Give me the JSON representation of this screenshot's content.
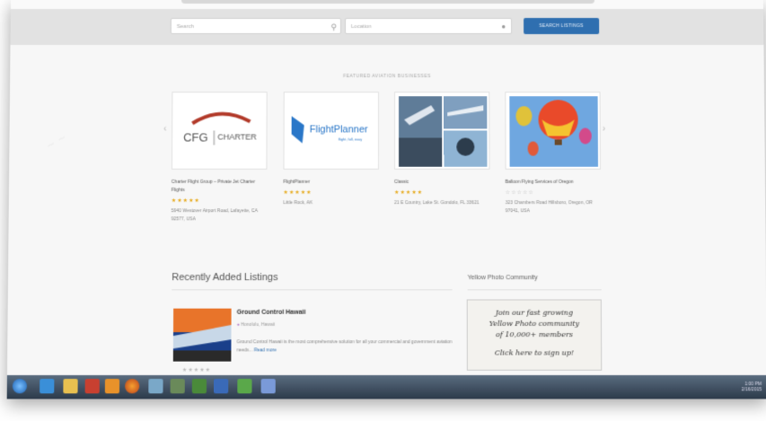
{
  "search": {
    "keyword_placeholder": "Search",
    "location_placeholder": "Location",
    "button_label": "SEARCH LISTINGS"
  },
  "featured": {
    "title": "FEATURED AVIATION BUSINESSES",
    "cards": [
      {
        "name": "Charter Flight Group – Private Jet Charter Flights",
        "stars": "★★★★★",
        "address": "5940 Westover Airport Road, Lafayette, CA 92577, USA"
      },
      {
        "name": "FlightPlanner",
        "stars": "★★★★★",
        "address": "Little Rock, AK"
      },
      {
        "name": "Classic",
        "stars": "★★★★★",
        "address": "21 E Country, Lake St. Gondolo, FL 33621"
      },
      {
        "name": "Balloon Flying Services of Oregon",
        "stars": "☆☆☆☆☆",
        "address": "323 Chambers Road Hillsboro, Oregon, OR 97041, USA"
      }
    ],
    "logo_cfg": "CFG",
    "logo_charter": "CHARTER",
    "logo_fp_brand": "FlightPlanner",
    "logo_fp_tag": "flight, full, easy"
  },
  "recent": {
    "title": "Recently Added Listings",
    "listing": {
      "name": "Ground Control Hawaii",
      "meta": "Honolulu, Hawaii",
      "description": "Ground Control Hawaii is the most comprehensive solution for all your commercial and government aviation needs...",
      "more": "Read more",
      "stars": "★★★★★"
    }
  },
  "photos": {
    "title": "Yellow Photo Community",
    "promo_lines": [
      "Join our fast growing",
      "Yellow Photo community",
      "of 10,000+ members",
      "Click here to sign up!"
    ]
  },
  "taskbar": {
    "time": "1:00 PM",
    "date": "2/16/2015"
  },
  "colors": {
    "accent": "#2f6fb0",
    "star": "#e6a817",
    "taskbar": "#3b4a5c"
  }
}
